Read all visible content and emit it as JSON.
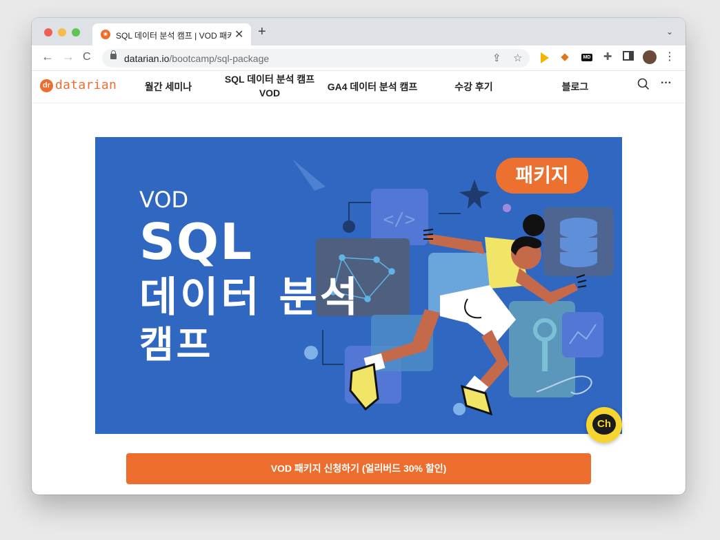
{
  "browser": {
    "tab_title": "SQL 데이터 분석 캠프 | VOD 패키지",
    "tab_close": "✕",
    "new_tab": "+",
    "tab_menu": "⌄",
    "url_host": "datarian.io",
    "url_path": "/bootcamp/sql-package",
    "nav_back": "←",
    "nav_forward": "→",
    "nav_reload": "C",
    "share": "⇪",
    "bookmark": "☆",
    "ext_md": "MD",
    "more": "⋮",
    "colors": {
      "tabstrip": "#dee1e6",
      "omnibox": "#f1f3f4"
    }
  },
  "site": {
    "logo_text": "datarian",
    "logo_glyph": "dr",
    "nav": [
      {
        "label": "월간 세미나"
      },
      {
        "label": "SQL 데이터 분석 캠프 VOD"
      },
      {
        "label": "GA4 데이터 분석 캠프"
      },
      {
        "label": "수강 후기"
      },
      {
        "label": "블로그"
      }
    ],
    "search_icon": "○",
    "more_icon": "···",
    "brand_color": "#ec6d2e"
  },
  "banner": {
    "line_vod": "VOD",
    "line_sql": "SQL",
    "line_analysis": "데이터 분석",
    "line_camp": "캠프",
    "badge": "패키지",
    "bg_color": "#2f67c1"
  },
  "chat": {
    "label": "Ch"
  },
  "cta": {
    "label": "VOD 패키지 신청하기 (얼리버드 30% 할인)"
  }
}
